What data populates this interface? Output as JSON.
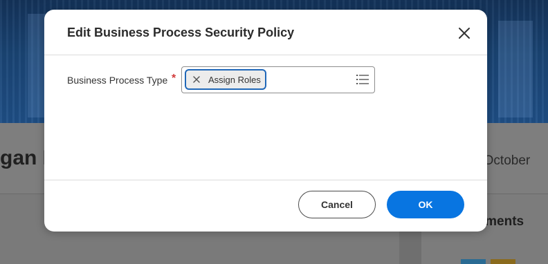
{
  "background": {
    "greeting_fragment": "gan M",
    "date_fragment": "y, October",
    "card_title_fragment": "cements"
  },
  "dialog": {
    "title": "Edit Business Process Security Policy",
    "close_icon": "close-icon",
    "field": {
      "label": "Business Process Type",
      "required_marker": "*",
      "selected_token": "Assign Roles",
      "token_remove_icon": "x-icon",
      "prompt_icon": "list-icon"
    },
    "buttons": {
      "cancel_label": "Cancel",
      "ok_label": "OK"
    }
  },
  "colors": {
    "primary_button": "#0875e1",
    "token_focus_border": "#1f67b8",
    "required": "#d13a3a",
    "banner": "#1a4575"
  }
}
